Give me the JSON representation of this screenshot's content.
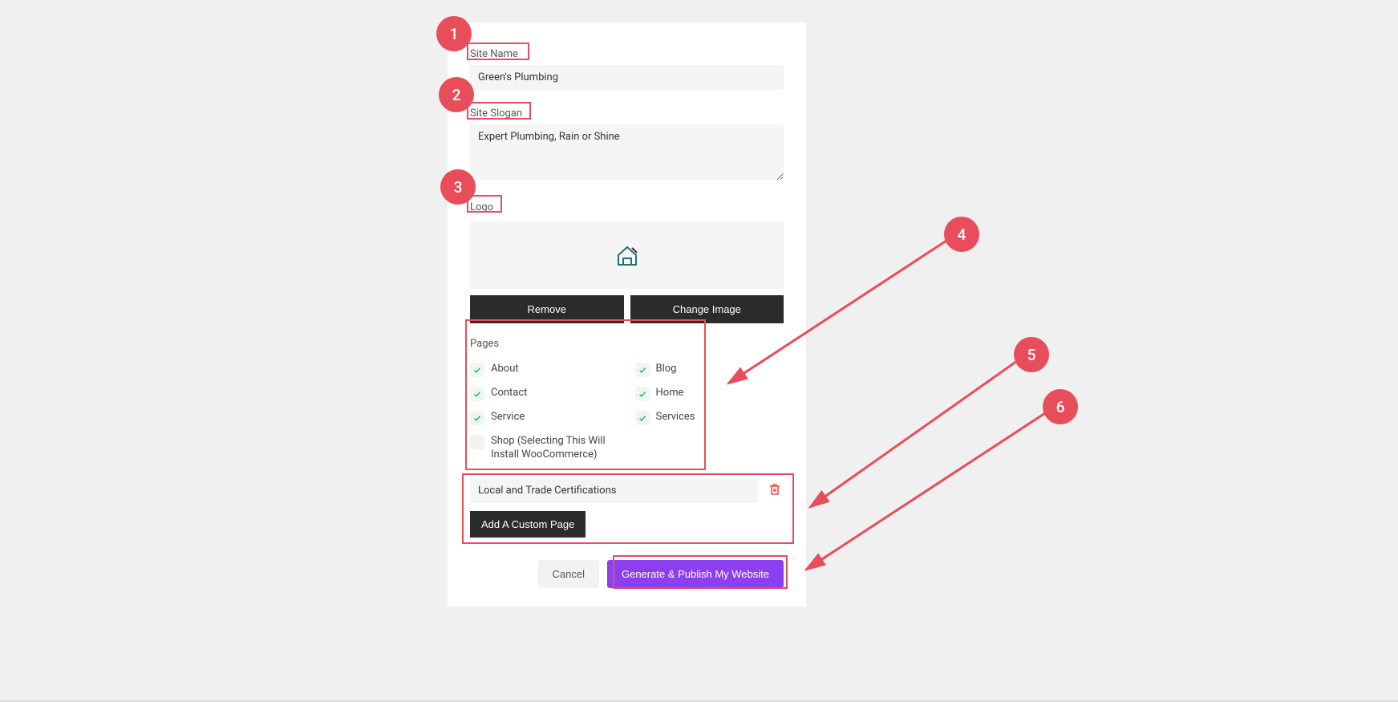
{
  "annotations": {
    "n1": "1",
    "n2": "2",
    "n3": "3",
    "n4": "4",
    "n5": "5",
    "n6": "6"
  },
  "site_name": {
    "label": "Site Name",
    "value": "Green's Plumbing"
  },
  "site_slogan": {
    "label": "Site Slogan",
    "value": "Expert Plumbing, Rain or Shine"
  },
  "logo": {
    "label": "Logo"
  },
  "buttons": {
    "remove": "Remove",
    "change_image": "Change Image",
    "add_custom_page": "Add A Custom Page",
    "cancel": "Cancel",
    "generate": "Generate & Publish My Website"
  },
  "pages": {
    "label": "Pages",
    "items": [
      {
        "label": "About",
        "checked": true
      },
      {
        "label": "Blog",
        "checked": true
      },
      {
        "label": "Contact",
        "checked": true
      },
      {
        "label": "Home",
        "checked": true
      },
      {
        "label": "Service",
        "checked": true
      },
      {
        "label": "Services",
        "checked": true
      },
      {
        "label": "Shop (Selecting This Will Install WooCommerce)",
        "checked": false
      }
    ]
  },
  "custom_page": {
    "value": "Local and Trade Certifications"
  }
}
